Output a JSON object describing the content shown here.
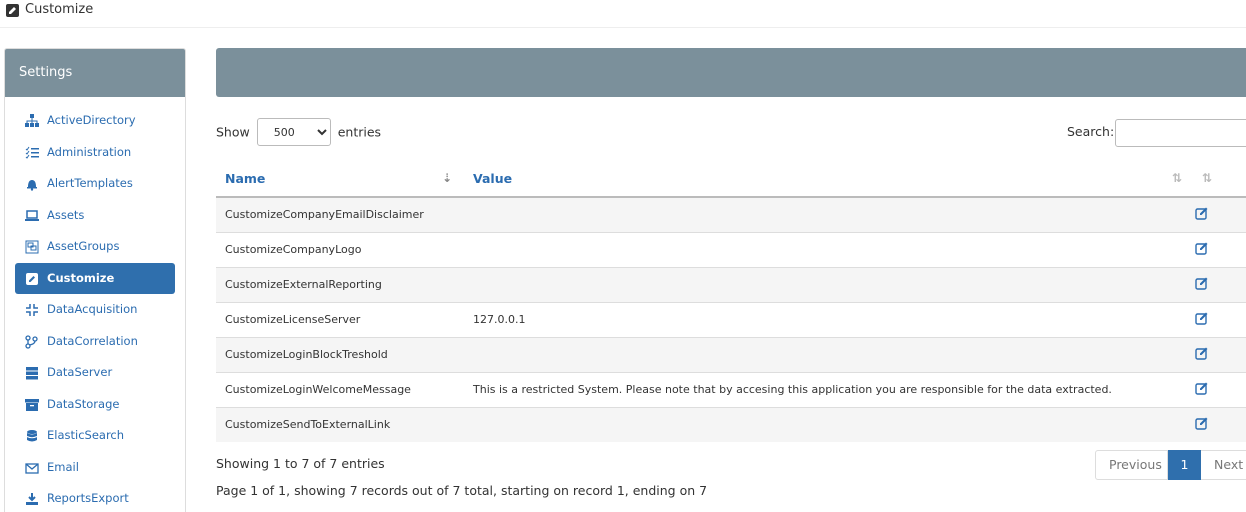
{
  "page": {
    "title": "Customize"
  },
  "sidebar": {
    "title": "Settings",
    "items": [
      {
        "label": "ActiveDirectory",
        "icon": "sitemap-icon"
      },
      {
        "label": "Administration",
        "icon": "list-check-icon"
      },
      {
        "label": "AlertTemplates",
        "icon": "bell-icon"
      },
      {
        "label": "Assets",
        "icon": "laptop-icon"
      },
      {
        "label": "AssetGroups",
        "icon": "object-group-icon"
      },
      {
        "label": "Customize",
        "icon": "edit-square-icon",
        "active": true
      },
      {
        "label": "DataAcquisition",
        "icon": "compress-icon"
      },
      {
        "label": "DataCorrelation",
        "icon": "code-branch-icon"
      },
      {
        "label": "DataServer",
        "icon": "server-icon"
      },
      {
        "label": "DataStorage",
        "icon": "archive-icon"
      },
      {
        "label": "ElasticSearch",
        "icon": "database-icon"
      },
      {
        "label": "Email",
        "icon": "envelope-icon"
      },
      {
        "label": "ReportsExport",
        "icon": "download-icon"
      }
    ]
  },
  "controls": {
    "show_label": "Show",
    "entries_label": "entries",
    "page_size": "500",
    "search_label": "Search:"
  },
  "table": {
    "columns": [
      "Name",
      "Value"
    ],
    "rows": [
      {
        "name": "CustomizeCompanyEmailDisclaimer",
        "value": ""
      },
      {
        "name": "CustomizeCompanyLogo",
        "value": ""
      },
      {
        "name": "CustomizeExternalReporting",
        "value": ""
      },
      {
        "name": "CustomizeLicenseServer",
        "value": "127.0.0.1"
      },
      {
        "name": "CustomizeLoginBlockTreshold",
        "value": ""
      },
      {
        "name": "CustomizeLoginWelcomeMessage",
        "value": "This is a restricted System. Please note that by accesing this application you are responsible for the data extracted."
      },
      {
        "name": "CustomizeSendToExternalLink",
        "value": ""
      }
    ]
  },
  "footer": {
    "showing": "Showing 1 to 7 of 7 entries",
    "page_info": "Page 1 of 1, showing 7 records out of 7 total, starting on record 1, ending on 7"
  },
  "pagination": {
    "previous": "Previous",
    "current": "1",
    "next": "Next"
  },
  "colors": {
    "header_bg": "#7b909b",
    "accent": "#2f6fad",
    "link": "#2b6cb0"
  }
}
